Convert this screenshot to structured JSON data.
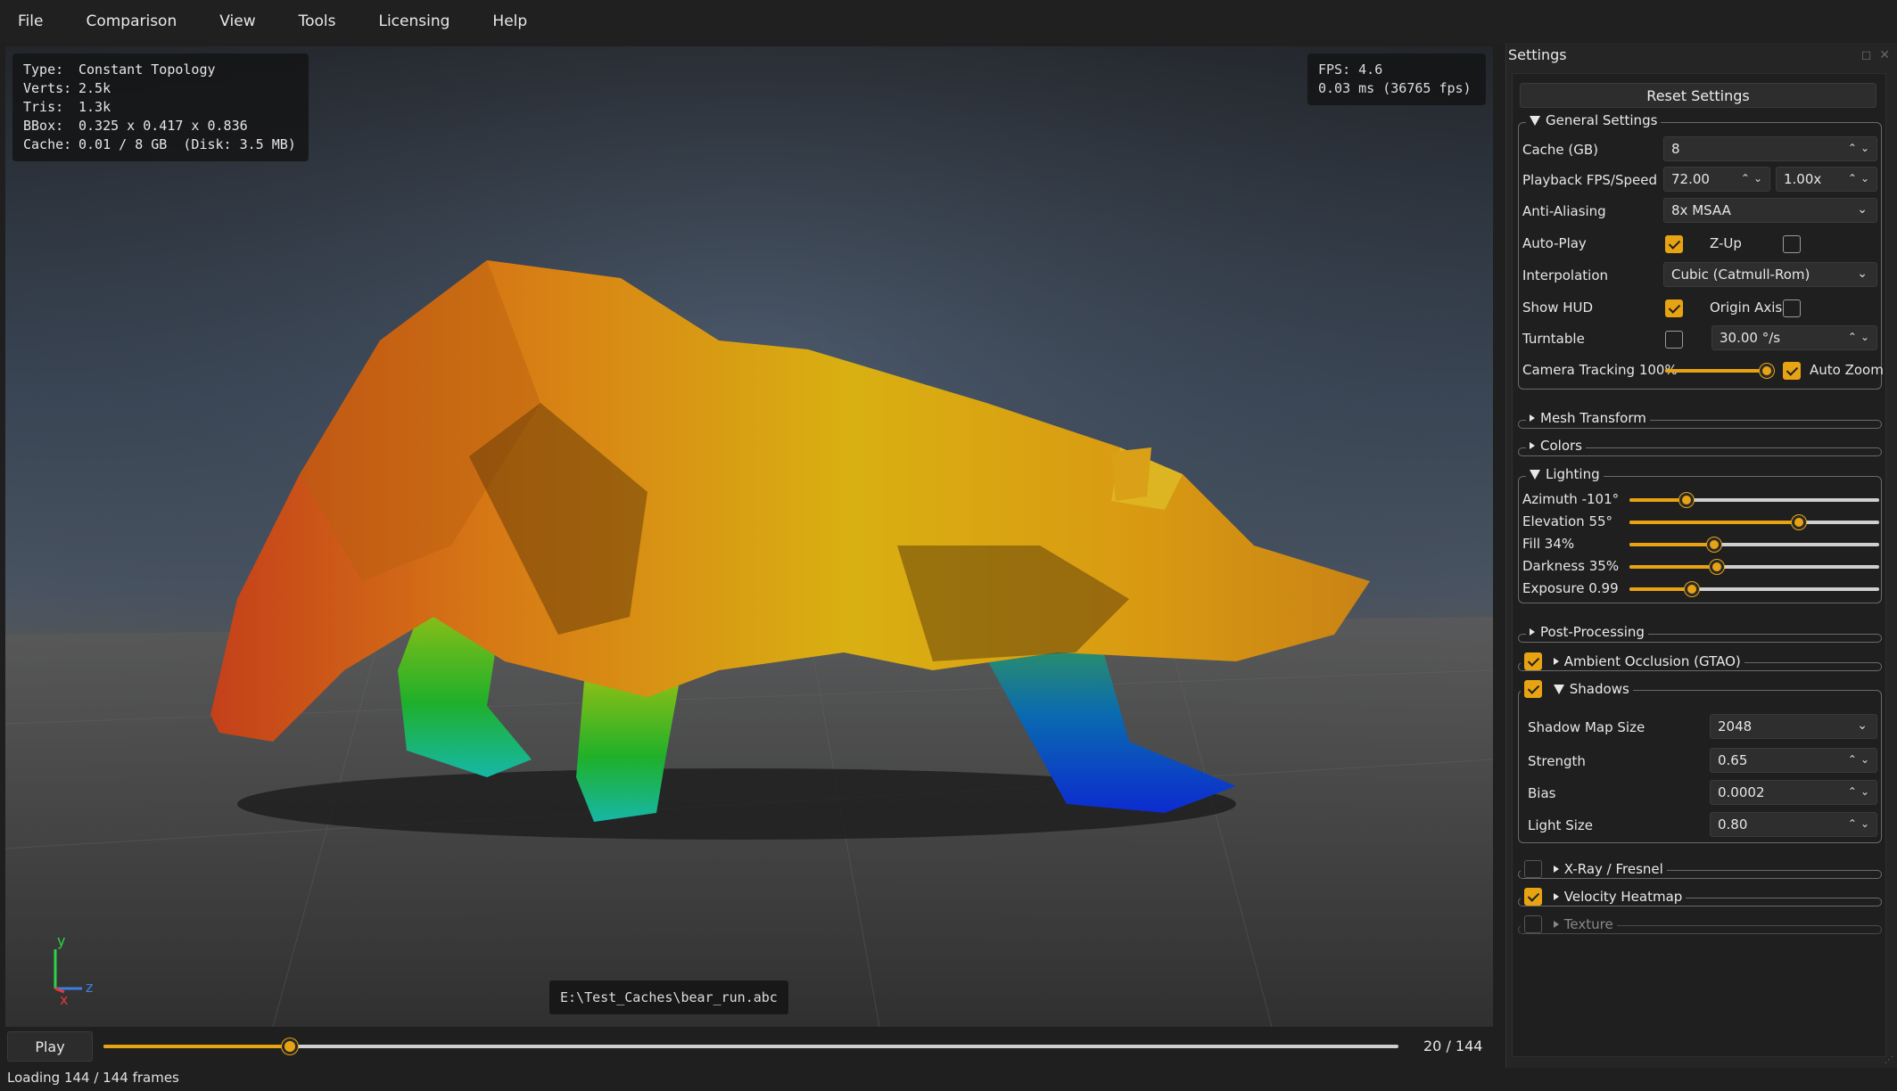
{
  "menu": [
    "File",
    "Comparison",
    "View",
    "Tools",
    "Licensing",
    "Help"
  ],
  "hud": {
    "type_label": "Type:",
    "type_value": "Constant Topology",
    "verts_label": "Verts:",
    "verts_value": "2.5k",
    "tris_label": "Tris:",
    "tris_value": "1.3k",
    "bbox_label": "BBox:",
    "bbox_value": "0.325 x 0.417 x 0.836",
    "cache_label": "Cache:",
    "cache_value": "0.01 / 8 GB  (Disk: 3.5 MB)",
    "fps": "FPS: 4.6",
    "frame_time": "0.03 ms (36765 fps)"
  },
  "viewport": {
    "file_path": "E:\\Test_Caches\\bear_run.abc",
    "axis": {
      "y": "y",
      "z": "z",
      "x": "x"
    }
  },
  "timeline": {
    "play_label": "Play",
    "frame_counter": "20 / 144",
    "progress": 0.144
  },
  "status": "Loading 144 / 144 frames",
  "settings": {
    "title": "Settings",
    "reset_label": "Reset Settings",
    "general": {
      "title": "General Settings",
      "cache_label": "Cache (GB)",
      "cache_value": "8",
      "playback_label": "Playback FPS/Speed",
      "fps_value": "72.00",
      "speed_value": "1.00x",
      "aa_label": "Anti-Aliasing",
      "aa_value": "8x MSAA",
      "autoplay_label": "Auto-Play",
      "autoplay_checked": true,
      "zup_label": "Z-Up",
      "zup_checked": false,
      "interp_label": "Interpolation",
      "interp_value": "Cubic (Catmull-Rom)",
      "hud_label": "Show HUD",
      "hud_checked": true,
      "origin_label": "Origin Axis",
      "origin_checked": false,
      "turntable_label": "Turntable",
      "turntable_checked": false,
      "turntable_value": "30.00 °/s",
      "tracking_label": "Camera Tracking 100%",
      "tracking": 1.0,
      "autozoom_label": "Auto Zoom",
      "autozoom_checked": true
    },
    "mesh_transform": "Mesh Transform",
    "colors": "Colors",
    "lighting": {
      "title": "Lighting",
      "azimuth_label": "Azimuth -101°",
      "azimuth": 0.23,
      "elevation_label": "Elevation 55°",
      "elevation": 0.68,
      "fill_label": "Fill 34%",
      "fill": 0.34,
      "darkness_label": "Darkness 35%",
      "darkness": 0.35,
      "exposure_label": "Exposure 0.99",
      "exposure": 0.25
    },
    "post_processing": "Post-Processing",
    "ao": {
      "label": "Ambient Occlusion (GTAO)",
      "checked": true
    },
    "shadows": {
      "label": "Shadows",
      "checked": true,
      "map_size_label": "Shadow Map Size",
      "map_size_value": "2048",
      "strength_label": "Strength",
      "strength_value": "0.65",
      "bias_label": "Bias",
      "bias_value": "0.0002",
      "light_size_label": "Light Size",
      "light_size_value": "0.80"
    },
    "xray": {
      "label": "X-Ray / Fresnel",
      "checked": false
    },
    "velocity": {
      "label": "Velocity Heatmap",
      "checked": true
    },
    "texture": {
      "label": "Texture",
      "checked": false
    }
  },
  "colors": {
    "accent": "#e8a312",
    "panel": "#1f1f1f",
    "viewport_top": "#23262b"
  }
}
